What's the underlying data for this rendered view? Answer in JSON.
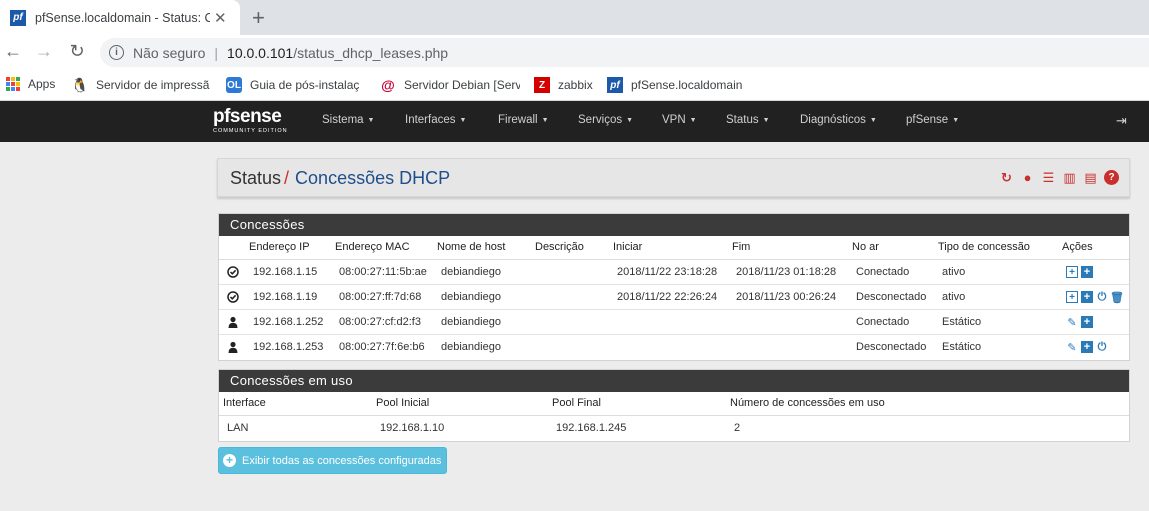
{
  "browser": {
    "tab_title": "pfSense.localdomain - Status: Co",
    "tab_favicon": "pf",
    "omnibox": {
      "security_label": "Não seguro",
      "separator": "|",
      "host": "10.0.0.101",
      "path": "/status_dhcp_leases.php"
    },
    "bookmarks": [
      {
        "label": "Apps",
        "icon": "apps-grid-icon"
      },
      {
        "label": "Servidor de impressã",
        "icon": "penguin-icon"
      },
      {
        "label": "Guia de pós-instalaç",
        "icon": "ol-icon"
      },
      {
        "label": "Servidor Debian [Serv",
        "icon": "debian-icon"
      },
      {
        "label": "zabbix",
        "icon": "zabbix-icon"
      },
      {
        "label": "pfSense.localdomain",
        "icon": "pf-icon"
      }
    ]
  },
  "navbar": {
    "logo_main": "pfsense",
    "logo_sub": "COMMUNITY EDITION",
    "menu": [
      "Sistema",
      "Interfaces",
      "Firewall",
      "Serviços",
      "VPN",
      "Status",
      "Diagnósticos",
      "pfSense"
    ]
  },
  "breadcrumb": {
    "parent": "Status",
    "slash": "/",
    "current": "Concessões DHCP",
    "icons": [
      "refresh-icon",
      "stop-icon",
      "sliders-icon",
      "bar-chart-icon",
      "list-icon",
      "help-icon"
    ]
  },
  "leases": {
    "title": "Concessões",
    "columns": [
      "Endereço IP",
      "Endereço MAC",
      "Nome de host",
      "Descrição",
      "Iniciar",
      "Fim",
      "No ar",
      "Tipo de concessão",
      "Ações"
    ],
    "rows": [
      {
        "status_icon": "check-circle-icon",
        "ip": "192.168.1.15",
        "mac": "08:00:27:11:5b:ae",
        "host": "debiandiego",
        "desc": "",
        "start": "2018/11/22 23:18:28",
        "end": "2018/11/23 01:18:28",
        "online": "Conectado",
        "type": "ativo",
        "actions": [
          "plus-outline-icon",
          "plus-icon"
        ]
      },
      {
        "status_icon": "check-circle-icon",
        "ip": "192.168.1.19",
        "mac": "08:00:27:ff:7d:68",
        "host": "debiandiego",
        "desc": "",
        "start": "2018/11/22 22:26:24",
        "end": "2018/11/23 00:26:24",
        "online": "Desconectado",
        "type": "ativo",
        "actions": [
          "plus-outline-icon",
          "plus-icon",
          "power-icon",
          "trash-icon"
        ]
      },
      {
        "status_icon": "user-icon",
        "ip": "192.168.1.252",
        "mac": "08:00:27:cf:d2:f3",
        "host": "debiandiego",
        "desc": "",
        "start": "",
        "end": "",
        "online": "Conectado",
        "type": "Estático",
        "actions": [
          "pencil-icon",
          "plus-icon"
        ]
      },
      {
        "status_icon": "user-icon",
        "ip": "192.168.1.253",
        "mac": "08:00:27:7f:6e:b6",
        "host": "debiandiego",
        "desc": "",
        "start": "",
        "end": "",
        "online": "Desconectado",
        "type": "Estático",
        "actions": [
          "pencil-icon",
          "plus-icon",
          "power-icon"
        ]
      }
    ]
  },
  "pools": {
    "title": "Concessões em uso",
    "columns": [
      "Interface",
      "Pool Inicial",
      "Pool Final",
      "Número de concessões em uso"
    ],
    "rows": [
      {
        "interface": "LAN",
        "start": "192.168.1.10",
        "end": "192.168.1.245",
        "count": "2"
      }
    ]
  },
  "show_all_button": "Exibir todas as concessões configuradas",
  "colors": {
    "navbar": "#212121",
    "panel_header": "#3b3b3b",
    "accent_red": "#c9302c",
    "link_blue": "#1f4e8c",
    "action_blue": "#2a7ab8",
    "info_button": "#5bc0de"
  }
}
